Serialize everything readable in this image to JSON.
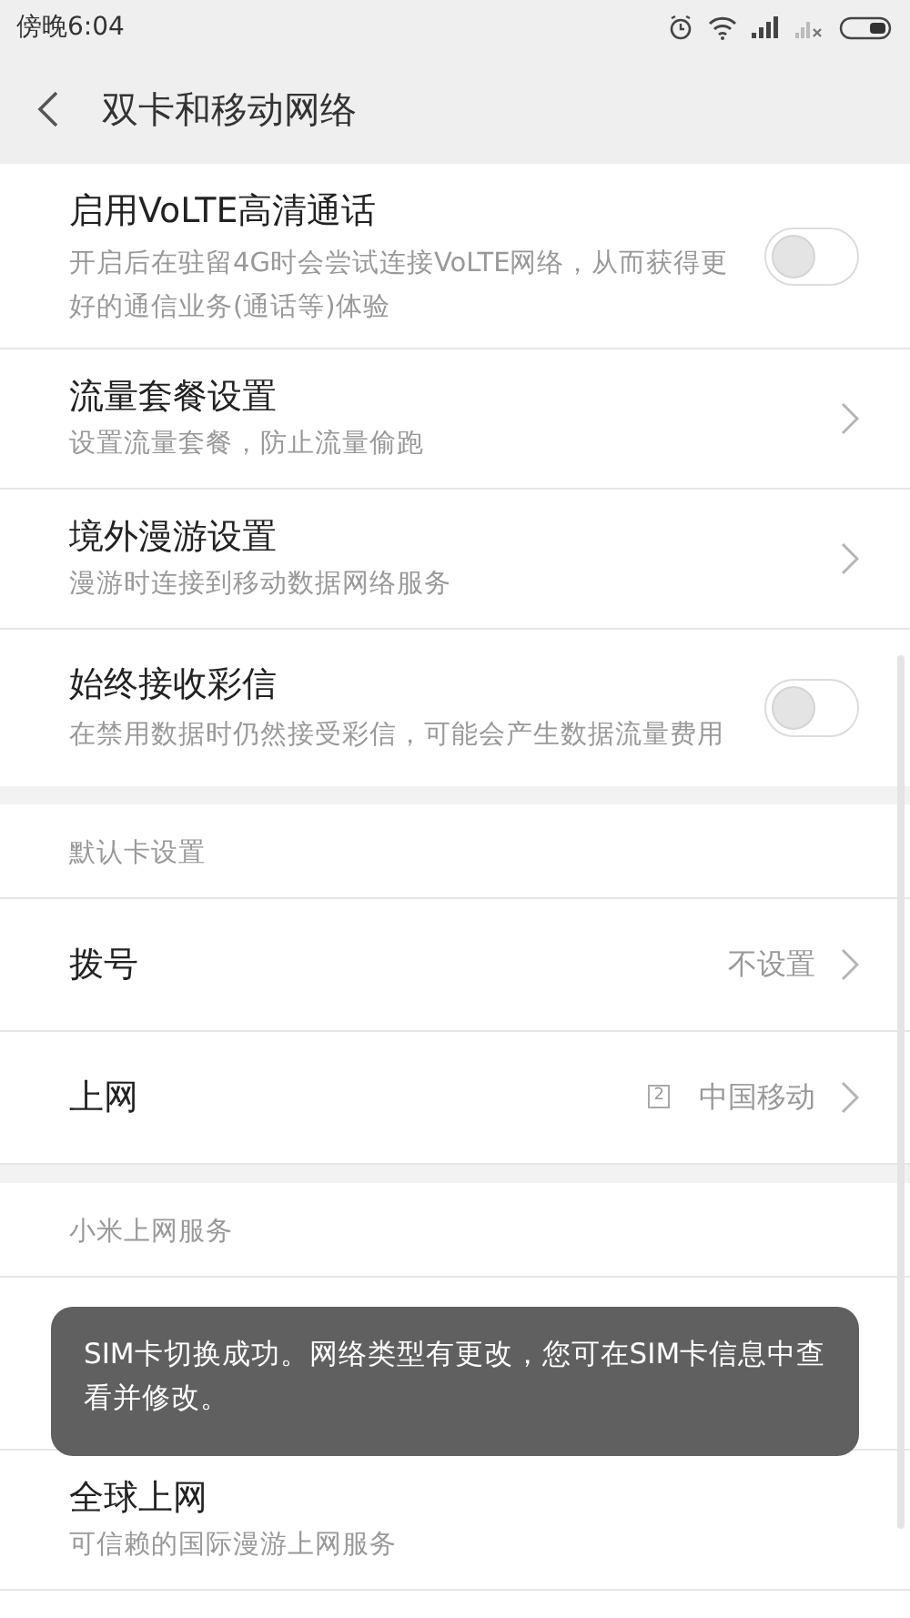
{
  "status_bar": {
    "time": "傍晚6:04"
  },
  "header": {
    "title": "双卡和移动网络"
  },
  "sections": [
    {
      "items": [
        {
          "kind": "toggle",
          "title": "启用VoLTE高清通话",
          "subtitle": "开启后在驻留4G时会尝试连接VoLTE网络，从而获得更好的通信业务(通话等)体验",
          "on": false
        },
        {
          "kind": "link",
          "title": "流量套餐设置",
          "subtitle": "设置流量套餐，防止流量偷跑"
        },
        {
          "kind": "link",
          "title": "境外漫游设置",
          "subtitle": "漫游时连接到移动数据网络服务"
        },
        {
          "kind": "toggle",
          "title": "始终接收彩信",
          "subtitle": "在禁用数据时仍然接受彩信，可能会产生数据流量费用",
          "on": false
        }
      ]
    },
    {
      "header": "默认卡设置",
      "items": [
        {
          "kind": "value",
          "title": "拨号",
          "value": "不设置"
        },
        {
          "kind": "value",
          "title": "上网",
          "badge": "2",
          "value": "中国移动"
        }
      ]
    },
    {
      "header": "小米上网服务",
      "items": [
        {
          "kind": "hidden"
        },
        {
          "kind": "plain",
          "title": "全球上网",
          "subtitle": "可信赖的国际漫游上网服务"
        }
      ]
    }
  ],
  "toast": {
    "text": "SIM卡切换成功。网络类型有更改，您可在SIM卡信息中查看并修改。"
  }
}
